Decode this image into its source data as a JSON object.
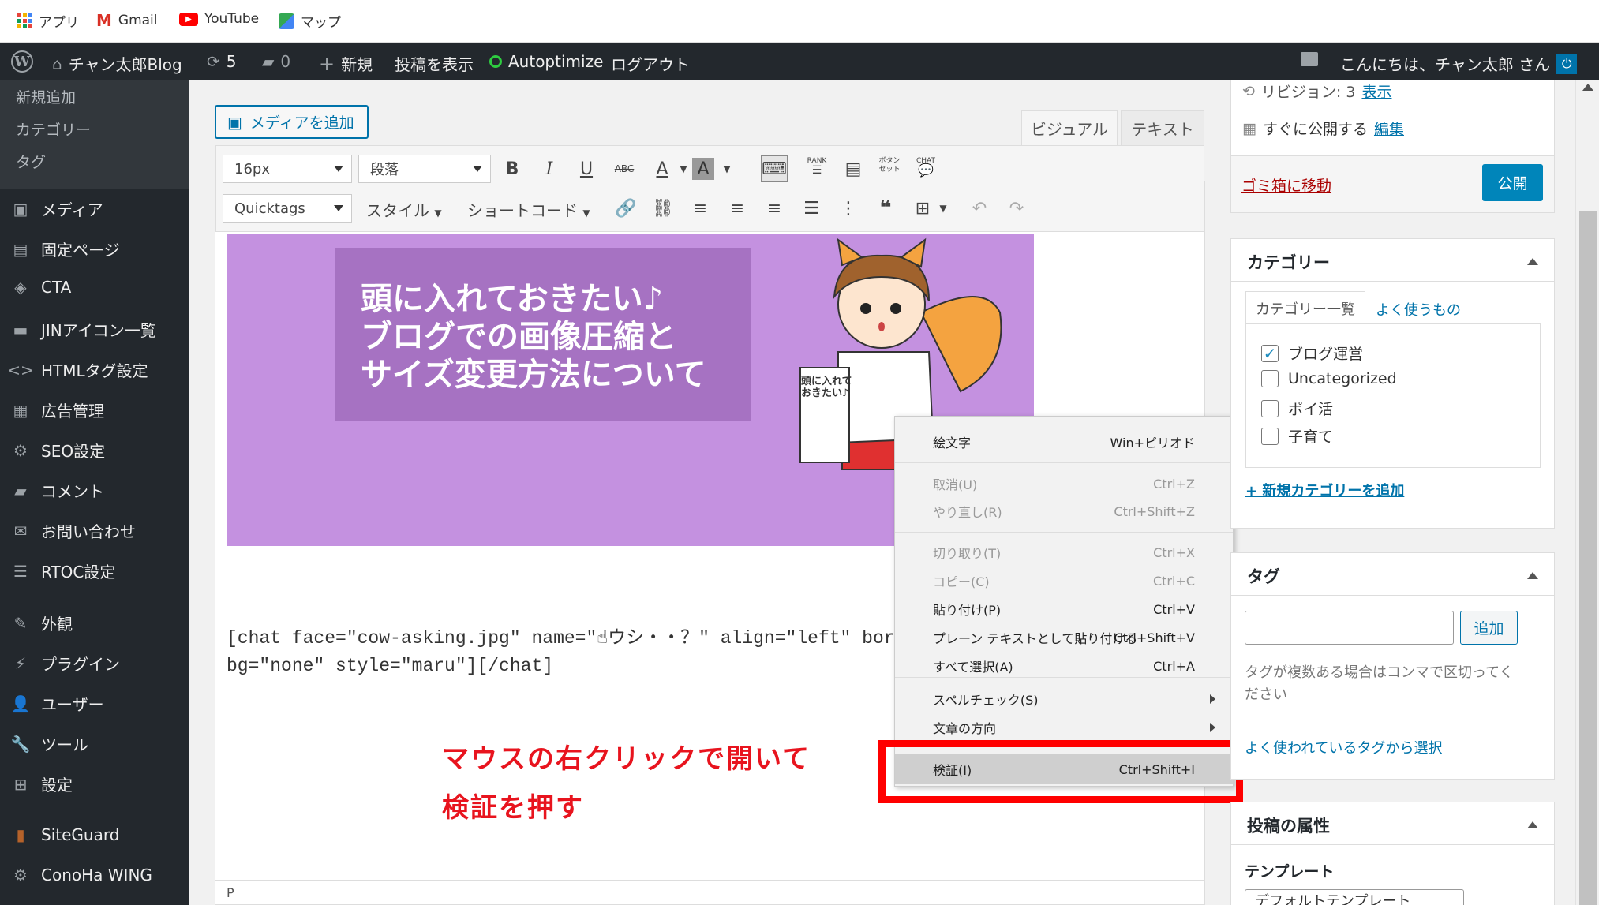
{
  "bookmarks": [
    {
      "label": "アプリ",
      "icon": "apps-grid-icon",
      "color": "#e8453c"
    },
    {
      "label": "Gmail",
      "icon": "gmail-icon",
      "color": "#d93025"
    },
    {
      "label": "YouTube",
      "icon": "youtube-icon",
      "color": "#ff0000"
    },
    {
      "label": "マップ",
      "icon": "maps-icon",
      "color": "#34a853"
    }
  ],
  "adminbar": {
    "wp_logo": "wordpress-logo-icon",
    "site_name": "チャン太郎Blog",
    "updates_count": "5",
    "comments_count": "0",
    "new_label": "新規",
    "view_post": "投稿を表示",
    "autoptimize": "Autoptimize",
    "logout": "ログアウト",
    "greeting": "こんにちは、チャン太郎 さん"
  },
  "leftmenu": {
    "submenu": [
      "新規追加",
      "カテゴリー",
      "タグ"
    ],
    "items": [
      {
        "label": "メディア",
        "icon": "media-icon"
      },
      {
        "label": "固定ページ",
        "icon": "page-icon"
      },
      {
        "label": "CTA",
        "icon": "cta-icon"
      },
      {
        "label": "JINアイコン一覧",
        "icon": "jin-icon"
      },
      {
        "label": "HTMLタグ設定",
        "icon": "code-icon"
      },
      {
        "label": "広告管理",
        "icon": "ad-icon"
      },
      {
        "label": "SEO設定",
        "icon": "gear-icon"
      },
      {
        "label": "コメント",
        "icon": "comment-icon"
      },
      {
        "label": "お問い合わせ",
        "icon": "mail-icon"
      },
      {
        "label": "RTOC設定",
        "icon": "list-icon"
      },
      {
        "label": "外観",
        "icon": "brush-icon"
      },
      {
        "label": "プラグイン",
        "icon": "plugin-icon"
      },
      {
        "label": "ユーザー",
        "icon": "user-icon"
      },
      {
        "label": "ツール",
        "icon": "wrench-icon"
      },
      {
        "label": "設定",
        "icon": "settings-icon"
      },
      {
        "label": "SiteGuard",
        "icon": "siteguard-icon"
      },
      {
        "label": "ConoHa WING",
        "icon": "conoha-icon"
      }
    ]
  },
  "editor": {
    "add_media": "メディアを追加",
    "tab_visual": "ビジュアル",
    "tab_text": "テキスト",
    "font_size": "16px",
    "paragraph": "段落",
    "quicktags": "Quicktags",
    "style_menu": "スタイル",
    "shortcode_menu": "ショートコード",
    "banner_lines": [
      "頭に入れておきたい♪",
      "ブログでの画像圧縮と",
      "サイズ変更方法について"
    ],
    "scroll_text": "頭に入れて\nおきたい♪",
    "content_line1": "[chat face=\"cow-asking.jpg\" name=\"☝ウシ・・？\" align=\"left\" bord",
    "content_line2": "bg=\"none\" style=\"maru\"][/chat]",
    "status_path": "P",
    "annotation_line1": "マウスの右クリックで開いて",
    "annotation_line2": "検証を押す",
    "toolbar_small": {
      "rank": "RANK",
      "button": "ボタン\nセット",
      "chat": "CHAT"
    }
  },
  "context_menu": [
    {
      "label": "絵文字",
      "shortcut": "Win+ピリオド",
      "disabled": false
    },
    {
      "label": "取消(U)",
      "shortcut": "Ctrl+Z",
      "disabled": true
    },
    {
      "label": "やり直し(R)",
      "shortcut": "Ctrl+Shift+Z",
      "disabled": true
    },
    {
      "label": "切り取り(T)",
      "shortcut": "Ctrl+X",
      "disabled": true
    },
    {
      "label": "コピー(C)",
      "shortcut": "Ctrl+C",
      "disabled": true
    },
    {
      "label": "貼り付け(P)",
      "shortcut": "Ctrl+V",
      "disabled": false
    },
    {
      "label": "プレーン テキストとして貼り付ける",
      "shortcut": "Ctrl+Shift+V",
      "disabled": false
    },
    {
      "label": "すべて選択(A)",
      "shortcut": "Ctrl+A",
      "disabled": false
    },
    {
      "label": "スペルチェック(S)",
      "shortcut": "",
      "disabled": false
    },
    {
      "label": "文章の方向",
      "shortcut": "",
      "disabled": false
    },
    {
      "label": "検証(I)",
      "shortcut": "Ctrl+Shift+I",
      "disabled": false
    }
  ],
  "publish": {
    "revision_label": "リビジョン: 3",
    "revision_link": "表示",
    "publish_now": "すぐに公開する",
    "edit_link": "編集",
    "trash": "ゴミ箱に移動",
    "publish_button": "公開"
  },
  "categories": {
    "title": "カテゴリー",
    "tab_all": "カテゴリー一覧",
    "tab_popular": "よく使うもの",
    "items": [
      {
        "label": "ブログ運営",
        "checked": true
      },
      {
        "label": "Uncategorized",
        "checked": false
      },
      {
        "label": "ポイ活",
        "checked": false
      },
      {
        "label": "子育て",
        "checked": false
      }
    ],
    "add_new": "+ 新規カテゴリーを追加"
  },
  "tags": {
    "title": "タグ",
    "add_button": "追加",
    "input_value": "",
    "help": "タグが複数ある場合はコンマで区切ってください",
    "help_line1": "タグが複数ある場合はコンマで区切ってく",
    "help_line2": "ださい",
    "choose_link": "よく使われているタグから選択"
  },
  "attributes": {
    "title": "投稿の属性",
    "template_label": "テンプレート",
    "template_value": "デフォルトテンプレート"
  },
  "colors": {
    "wp_blue": "#0073aa",
    "admin_dark": "#23282d",
    "red": "#e8141e",
    "banner": "#c491e0"
  }
}
